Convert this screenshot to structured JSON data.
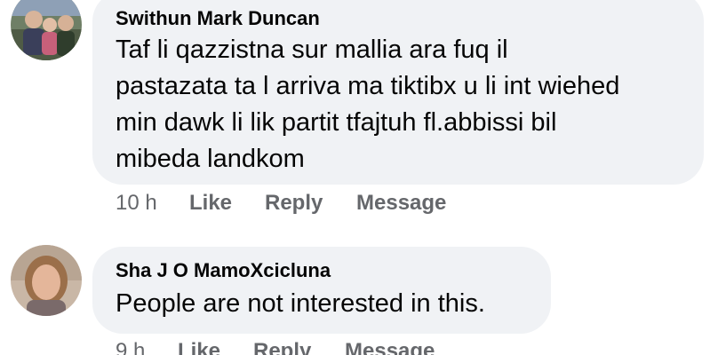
{
  "comments": [
    {
      "author": "Swithun Mark Duncan",
      "text": "Taf li qazzistna sur mallia ara fuq il pastazata ta l arriva ma tiktibx u li int wiehed min dawk li lik partit tfajtuh fl.abbissi bil mibeda landkom",
      "lines": [
        "Taf li qazzistna sur mallia ara fuq il",
        "pastazata ta l arriva ma tiktibx u li int wiehed",
        "min dawk li lik partit tfajtuh fl.abbissi bil",
        "mibeda landkom"
      ],
      "time": "10 h",
      "like": "Like",
      "reply": "Reply",
      "message": "Message"
    },
    {
      "author": "Sha J O MamoXcicluna",
      "text": "People are not interested in this.",
      "time": "9 h",
      "like": "Like",
      "reply": "Reply",
      "message": "Message"
    }
  ],
  "colors": {
    "bubble": "#f0f2f5",
    "text": "#050505",
    "meta": "#65676b"
  }
}
